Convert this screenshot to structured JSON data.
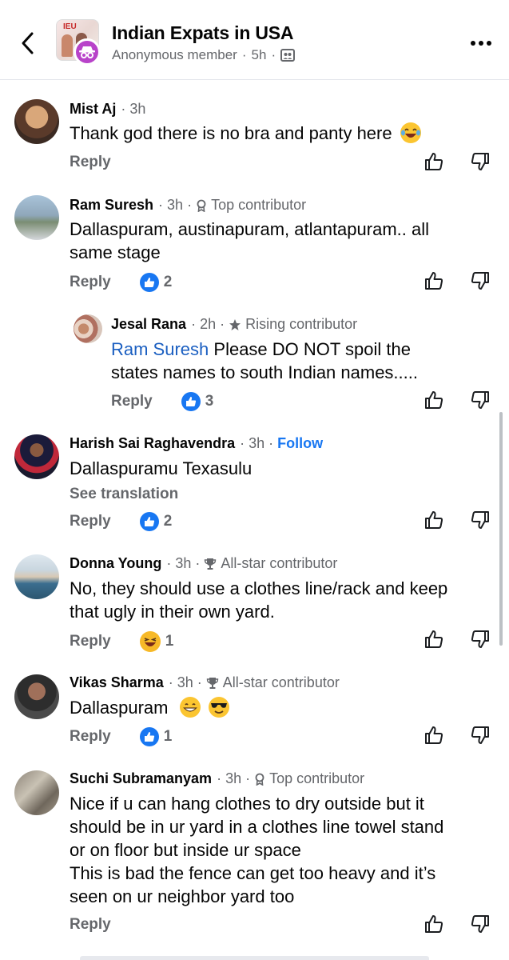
{
  "header": {
    "title": "Indian Expats in USA",
    "subtitle": "Anonymous member",
    "time": "5h",
    "separator": "·",
    "thumb_text": "IEU"
  },
  "comments": [
    {
      "name": "Mist Aj",
      "time": "3h",
      "badge": "",
      "text": "Thank god there is no bra and panty here",
      "emoji": "haha",
      "reply_label": "Reply",
      "reaction_count": ""
    },
    {
      "name": "Ram Suresh",
      "time": "3h",
      "badge": "Top contributor",
      "badge_icon": "top-contributor-icon",
      "text_line1": "Dallaspuram, austinapuram, atlantapuram.. all",
      "text_line2": "same stage",
      "reply_label": "Reply",
      "reaction_count": "2"
    },
    {
      "name": "Jesal Rana",
      "time": "2h",
      "badge": "Rising contributor",
      "badge_icon": "star-icon",
      "mention": "Ram Suresh",
      "text_line1": " Please DO NOT spoil the",
      "text_line2": "states names to south Indian names.....",
      "reply_label": "Reply",
      "reaction_count": "3"
    },
    {
      "name": "Harish Sai Raghavendra",
      "time": "3h",
      "follow": "Follow",
      "text": "Dallaspuramu Texasulu",
      "see_translation": "See translation",
      "reply_label": "Reply",
      "reaction_count": "2"
    },
    {
      "name": "Donna Young",
      "time": "3h",
      "badge": "All-star contributor",
      "badge_icon": "trophy-icon",
      "text_line1": "No, they should use a clothes line/rack and keep",
      "text_line2": "that ugly in their own yard.",
      "reply_label": "Reply",
      "reaction_count": "1",
      "reaction_type": "haha"
    },
    {
      "name": "Vikas Sharma",
      "time": "3h",
      "badge": "All-star contributor",
      "badge_icon": "trophy-icon",
      "text": "Dallaspuram",
      "emoji": [
        "grin",
        "sunglasses"
      ],
      "reply_label": "Reply",
      "reaction_count": "1"
    },
    {
      "name": "Suchi Subramanyam",
      "time": "3h",
      "badge": "Top contributor",
      "badge_icon": "top-contributor-icon",
      "text_line1": "Nice if u can hang clothes to dry outside but it",
      "text_line2": "should be in ur yard in a clothes line towel stand",
      "text_line3": "or on floor but inside ur space",
      "text_line4": "This is bad the fence can get too heavy and it’s",
      "text_line5": "seen on ur neighbor yard too",
      "reply_label": "Reply",
      "reaction_count": ""
    }
  ],
  "colors": {
    "accent": "#1877f2",
    "mention": "#1b5fc1",
    "meta": "#65676b",
    "anon_badge": "#b843c9"
  }
}
